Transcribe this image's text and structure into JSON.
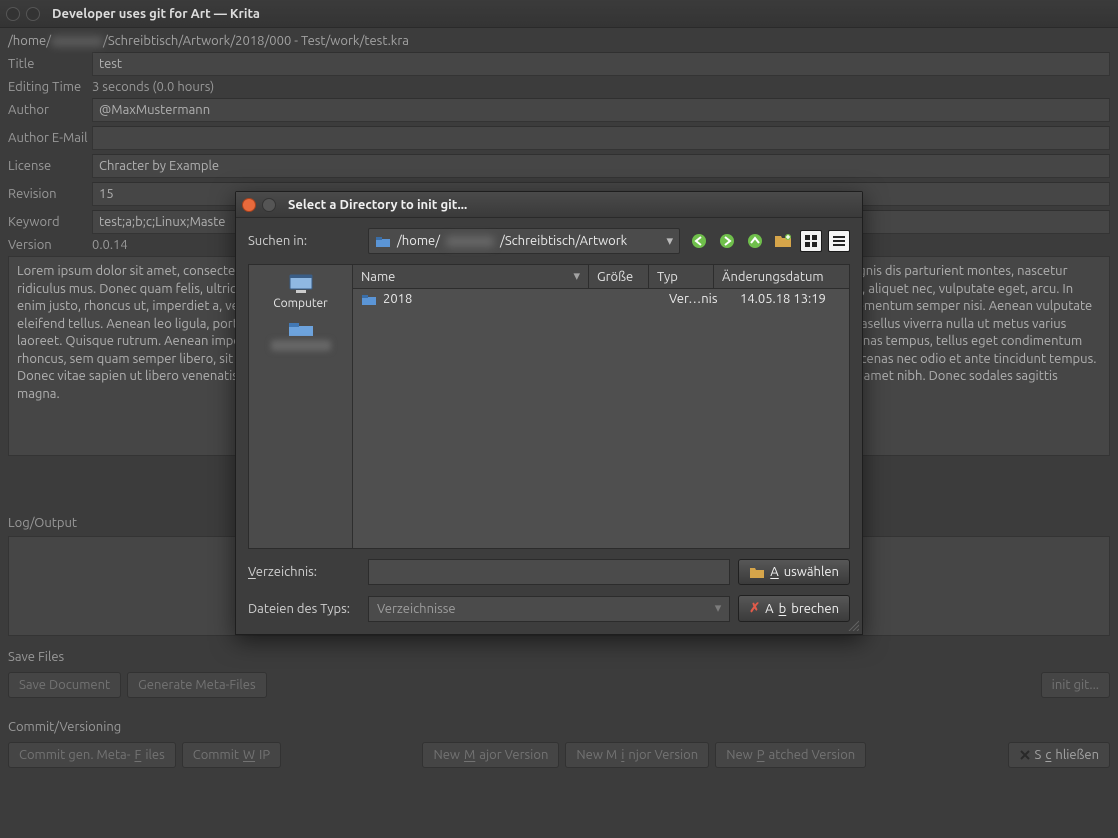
{
  "window": {
    "title": "Developer uses git for Art — Krita"
  },
  "file_path_prefix": "/home/",
  "file_path_suffix": "/Schreibtisch/Artwork/2018/000 - Test/work/test.kra",
  "fields": {
    "title": {
      "label": "Title",
      "value": "test"
    },
    "editing_time": {
      "label": "Editing Time",
      "value": "3 seconds  (0.0 hours)"
    },
    "author": {
      "label": "Author",
      "value": "@MaxMustermann"
    },
    "author_email": {
      "label": "Author E-Mail",
      "value": ""
    },
    "license": {
      "label": "License",
      "value": "Chracter by Example"
    },
    "revision": {
      "label": "Revision",
      "value": "15"
    },
    "keyword": {
      "label": "Keyword",
      "value": "test;a;b;c;Linux;Maste"
    },
    "version": {
      "label": "Version",
      "value": "0.0.14"
    }
  },
  "description": "Lorem ipsum dolor sit amet, consectetuer adipiscing elit. Aenean commodo ligula eget dolor. Aenean massa. Cum sociis natoque penatibus et magnis dis parturient montes, nascetur ridiculus mus. Donec quam felis, ultricies nec, pellentesque eu, pretium quis, sem. Nulla consequat massa quis enim. Donec pede justo, fringilla vel, aliquet nec, vulputate eget, arcu. In enim justo, rhoncus ut, imperdiet a, venenatis vitae, justo. Nullam dictum felis eu pede mollis pretium. Integer tincidunt. Cras dapibus. Vivamus elementum semper nisi. Aenean vulputate eleifend tellus. Aenean leo ligula, porttitor eu, consequat vitae, eleifend ac, enim. Aliquam lorem ante, dapibus in, viverra quis, feugiat a, tellus. Phasellus viverra nulla ut metus varius laoreet. Quisque rutrum. Aenean imperdiet. Etiam ultricies nisi vel augue. Curabitur ullamcorper ultricies nisi. Nam eget dui. Etiam rhoncus. Maecenas tempus, tellus eget condimentum rhoncus, sem quam semper libero, sit amet adipiscing sem neque sed ipsum. Nam quam nunc, blandit vel, luctus pulvinar, hendrerit id, lorem. Maecenas nec odio et ante tincidunt tempus. Donec vitae sapien ut libero venenatis faucibus. Nullam quis ante. Etiam sit amet orci eget eros faucibus tincidunt. Duis leo. Sed fringilla mauris sit amet nibh. Donec sodales sagittis magna.",
  "log_label": "Log/Output",
  "sections": {
    "save_files": "Save Files",
    "commit": "Commit/Versioning"
  },
  "buttons": {
    "save_document": "Save Document",
    "generate_meta": "Generate Meta-Files",
    "init_git": "init git...",
    "commit_meta": {
      "pre": "Commit gen. Meta-",
      "mn": "F",
      "post": "iles"
    },
    "commit_wip": {
      "pre": "Commit ",
      "mn": "W",
      "post": "IP"
    },
    "new_major": {
      "pre": "New ",
      "mn": "M",
      "post": "ajor Version"
    },
    "new_minor": {
      "pre": "New M",
      "mn": "i",
      "post": "njor Version"
    },
    "new_patched": {
      "pre": "New ",
      "mn": "P",
      "post": "atched Version"
    },
    "close": {
      "pre": "S",
      "mn": "c",
      "post": "hließen"
    }
  },
  "dialog": {
    "title": "Select a Directory to init git...",
    "search_in_label": "Suchen in:",
    "path_prefix": "/home/",
    "path_suffix": "/Schreibtisch/Artwork",
    "nav_icons": [
      "back-icon",
      "forward-icon",
      "up-icon",
      "new-folder-icon",
      "icons-view-icon",
      "list-view-icon"
    ],
    "sidebar": {
      "computer": "Computer"
    },
    "columns": {
      "name": "Name",
      "size": "Größe",
      "type": "Typ",
      "date": "Änderungsdatum"
    },
    "rows": [
      {
        "name": "2018",
        "size": "",
        "type": "Ver…nis",
        "date": "14.05.18 13:19"
      }
    ],
    "dir_label": {
      "mn": "V",
      "post": "erzeichnis:"
    },
    "filetype_label": "Dateien des Typs:",
    "filetype_value": "Verzeichnisse",
    "choose_btn": {
      "mn": "A",
      "post": "uswählen"
    },
    "cancel_btn": {
      "pre": "A",
      "mn": "b",
      "post": "brechen"
    }
  }
}
